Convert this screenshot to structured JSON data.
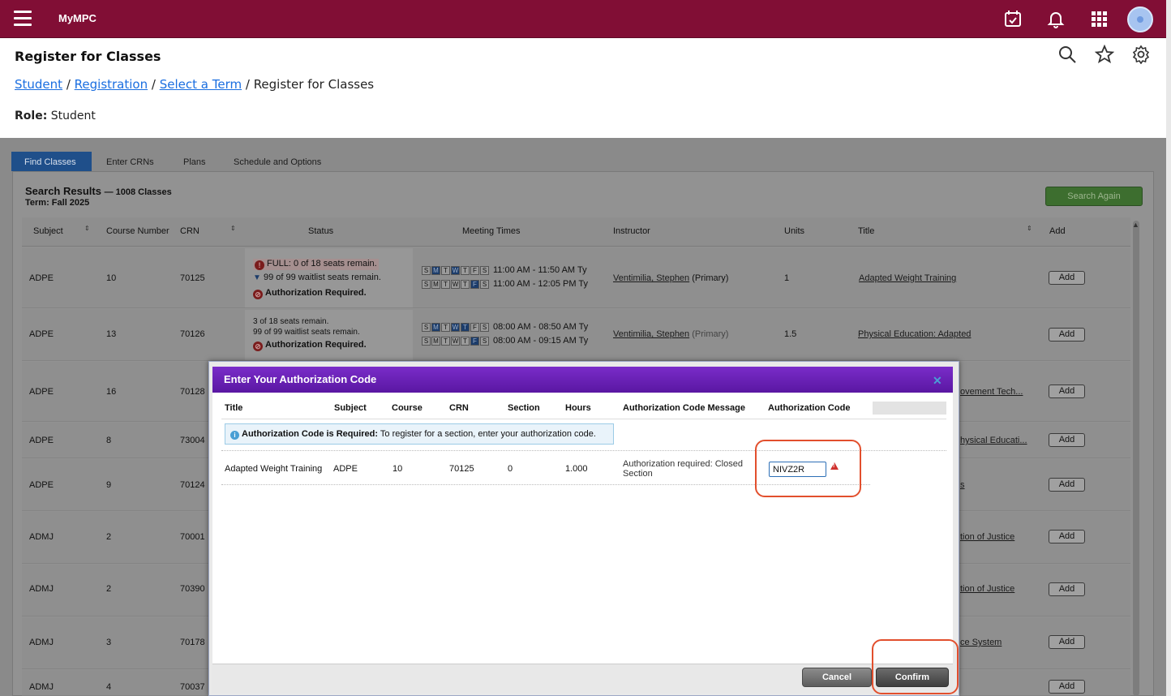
{
  "app": {
    "name": "MyMPC"
  },
  "header": {
    "page_title": "Register for Classes",
    "breadcrumb": {
      "student": "Student",
      "registration": "Registration",
      "select_term": "Select a Term",
      "current": "Register for Classes"
    },
    "role_label": "Role:",
    "role_value": "Student"
  },
  "tabs": [
    "Find Classes",
    "Enter CRNs",
    "Plans",
    "Schedule and Options"
  ],
  "search": {
    "title": "Search Results",
    "count": "— 1008 Classes",
    "term": "Term: Fall 2025",
    "search_again": "Search Again"
  },
  "table": {
    "columns": [
      "Subject",
      "Course Number",
      "CRN",
      "Status",
      "Meeting Times",
      "Instructor",
      "Units",
      "Title",
      "Add"
    ],
    "add_label": "Add",
    "rows": [
      {
        "subject": "ADPE",
        "course": "10",
        "crn": "70125",
        "status1": "FULL: 0 of 18 seats remain.",
        "status2": "99 of 99 waitlist seats remain.",
        "status3": "Authorization Required.",
        "time1": "11:00 AM - 11:50 AM Ty",
        "time2": "11:00 AM - 12:05 PM Ty",
        "instructor": "Ventimilia, Stephen",
        "primary": "(Primary)",
        "units": "1",
        "title": "Adapted Weight Training"
      },
      {
        "subject": "ADPE",
        "course": "13",
        "crn": "70126",
        "status1": "3 of 18 seats remain.",
        "status2": "99 of 99 waitlist seats remain.",
        "status3": "Authorization Required.",
        "time1": "08:00 AM - 08:50 AM Ty",
        "time2": "08:00 AM - 09:15 AM Ty",
        "instructor": "Ventimilia, Stephen",
        "primary": "(Primary)",
        "units": "1.5",
        "title": "Physical Education: Adapted"
      },
      {
        "subject": "ADPE",
        "course": "16",
        "crn": "70128",
        "title": "ovement Tech..."
      },
      {
        "subject": "ADPE",
        "course": "8",
        "crn": "73004",
        "title": "hysical Educati..."
      },
      {
        "subject": "ADPE",
        "course": "9",
        "crn": "70124",
        "title": "s"
      },
      {
        "subject": "ADMJ",
        "course": "2",
        "crn": "70001",
        "title": "tion of Justice"
      },
      {
        "subject": "ADMJ",
        "course": "2",
        "crn": "70390",
        "title": "tion of Justice"
      },
      {
        "subject": "ADMJ",
        "course": "3",
        "crn": "70178",
        "title": "ce System"
      },
      {
        "subject": "ADMJ",
        "course": "4",
        "crn": "70037",
        "title": ""
      }
    ]
  },
  "days": [
    "S",
    "M",
    "T",
    "W",
    "T",
    "F",
    "S"
  ],
  "modal": {
    "title": "Enter Your Authorization Code",
    "columns": [
      "Title",
      "Subject",
      "Course",
      "CRN",
      "Section",
      "Hours",
      "Authorization Code Message",
      "Authorization Code"
    ],
    "info_bold": "Authorization Code is Required:",
    "info_text": " To register for a section, enter your authorization code.",
    "row": {
      "title": "Adapted Weight Training",
      "subject": "ADPE",
      "course": "10",
      "crn": "70125",
      "section": "0",
      "hours": "1.000",
      "message": "Authorization required: Closed Section",
      "code": "NIVZ2R"
    },
    "cancel": "Cancel",
    "confirm": "Confirm"
  },
  "icons": [
    "menu-icon",
    "calendar-check-icon",
    "bell-icon",
    "apps-grid-icon",
    "search-icon",
    "star-icon",
    "gear-icon",
    "close-icon",
    "info-icon",
    "warning-icon",
    "sort-icon"
  ],
  "colors": {
    "brand": "#810e35",
    "modal_header": "#6a20b5",
    "link": "#1a6ee0",
    "highlight": "#e24f2d"
  }
}
